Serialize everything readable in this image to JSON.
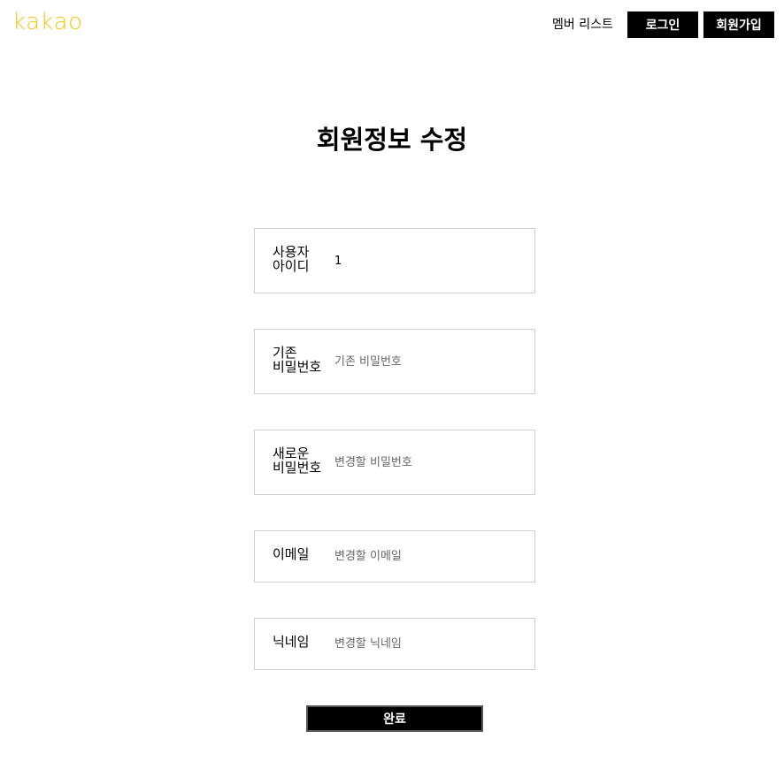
{
  "header": {
    "logo_text": "kakao",
    "member_list_link": "멤버 리스트",
    "login_button": "로그인",
    "signup_button": "회원가입"
  },
  "colors": {
    "logo": "#f5c518",
    "button_bg": "#000000",
    "button_text": "#ffffff",
    "field_border": "#cfcfcf"
  },
  "form": {
    "title": "회원정보 수정",
    "fields": [
      {
        "label": "사용자 아이디",
        "value": "1",
        "placeholder": ""
      },
      {
        "label": "기존 비밀번호",
        "value": "",
        "placeholder": "기존 비밀번호"
      },
      {
        "label": "새로운 비밀번호",
        "value": "",
        "placeholder": "변경할 비밀번호"
      },
      {
        "label": "이메일",
        "value": "",
        "placeholder": "변경할 이메일"
      },
      {
        "label": "닉네임",
        "value": "",
        "placeholder": "변경할 닉네임"
      }
    ],
    "submit_label": "완료"
  }
}
